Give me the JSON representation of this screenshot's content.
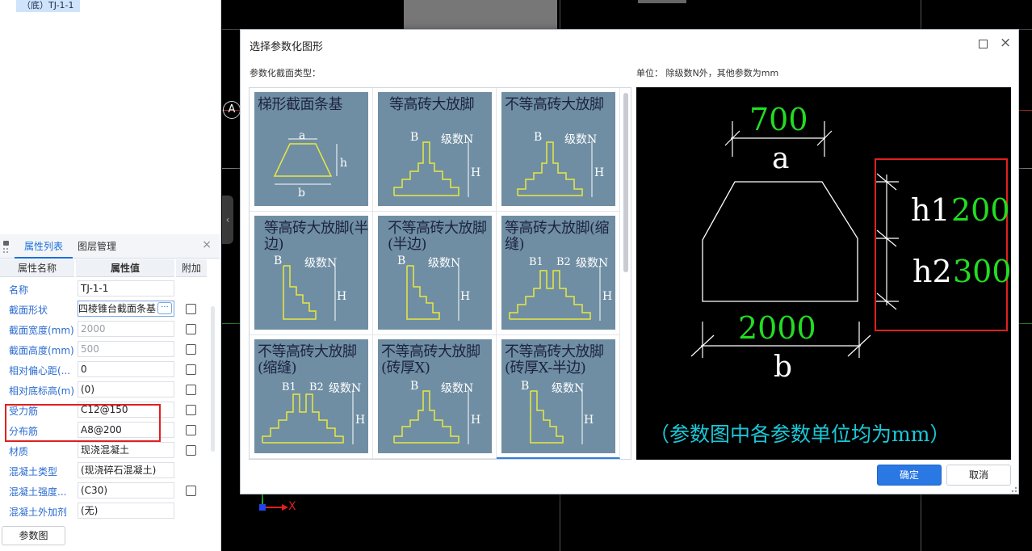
{
  "tree": {
    "selected_item": "（底）TJ-1-1"
  },
  "props_panel": {
    "tabs": [
      "属性列表",
      "图层管理"
    ],
    "close": "×",
    "headers": {
      "name": "属性名称",
      "value": "属性值",
      "extra": "附加"
    },
    "rows": [
      {
        "name": "名称",
        "value": "TJ-1-1"
      },
      {
        "name": "截面形状",
        "value": "四棱锥台截面条基"
      },
      {
        "name": "截面宽度(mm)",
        "value": "2000"
      },
      {
        "name": "截面高度(mm)",
        "value": "500"
      },
      {
        "name": "相对偏心距(...",
        "value": "0"
      },
      {
        "name": "相对底标高(m)",
        "value": "(0)"
      },
      {
        "name": "受力筋",
        "value": "C12@150"
      },
      {
        "name": "分布筋",
        "value": "A8@200"
      },
      {
        "name": "材质",
        "value": "现浇混凝土"
      },
      {
        "name": "混凝土类型",
        "value": "(现浇碎石混凝土)"
      },
      {
        "name": "混凝土强度...",
        "value": "(C30)"
      },
      {
        "name": "混凝土外加剂",
        "value": "(无)"
      }
    ],
    "ellipsis": "···",
    "param_button": "参数图"
  },
  "cad": {
    "axis_label": "A",
    "ucs_x": "X",
    "collapse": "‹"
  },
  "dialog": {
    "title": "选择参数化图形",
    "label_type": "参数化截面类型：",
    "label_unit": "单位：  除级数N外，其他参数为mm",
    "shapes": [
      {
        "title": "梯形截面条基",
        "kind": "trap"
      },
      {
        "title": "等高砖大放脚",
        "kind": "step-sym"
      },
      {
        "title": "不等高砖大放脚",
        "kind": "step-sym2"
      },
      {
        "title": "等高砖大放脚(半边)",
        "kind": "step-half"
      },
      {
        "title": "不等高砖大放脚(半边)",
        "kind": "step-half2"
      },
      {
        "title": "等高砖大放脚(缩缝)",
        "kind": "step-gap"
      },
      {
        "title": "不等高砖大放脚(缩缝)",
        "kind": "step-gap2"
      },
      {
        "title": "不等高砖大放脚(砖厚X)",
        "kind": "step-x"
      },
      {
        "title": "不等高砖大放脚(砖厚X-半边)",
        "kind": "step-xhalf"
      }
    ],
    "labels": {
      "a": "a",
      "b": "b",
      "h": "h",
      "B": "B",
      "N": "级数N",
      "H": "H",
      "B1": "B1",
      "B2": "B2"
    },
    "preview": {
      "a_value": "700",
      "a_label": "a",
      "b_value": "2000",
      "b_label": "b",
      "h1_label": "h1",
      "h1_value": "200",
      "h2_label": "h2",
      "h2_value": "300",
      "note": "（参数图中各参数单位均为mm）",
      "colors": {
        "value": "#22dd22",
        "label": "#ffffff",
        "note": "#19c8d8",
        "highlight": "#e02020"
      }
    },
    "ok": "确定",
    "cancel": "取消",
    "close": "×"
  }
}
